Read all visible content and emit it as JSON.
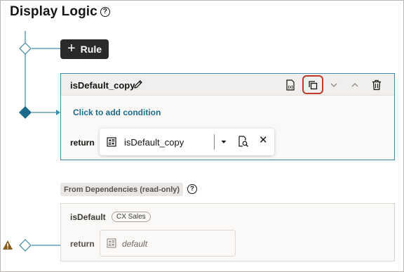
{
  "page": {
    "title": "Display Logic"
  },
  "toolbar": {
    "add_rule_label": "Rule"
  },
  "rule": {
    "name": "isDefault_copy",
    "add_condition_label": "Click to add condition",
    "return_label": "return",
    "return_value": "isDefault_copy",
    "header_icons": [
      "test-icon",
      "duplicate-icon",
      "chevron-down-icon",
      "chevron-up-icon",
      "trash-icon"
    ]
  },
  "dependencies": {
    "badge_label": "From Dependencies (read-only)",
    "items": [
      {
        "name": "isDefault",
        "tag": "CX Sales",
        "return_label": "return",
        "return_placeholder": "default"
      }
    ]
  },
  "colors": {
    "connector": "#3f8aa8",
    "rule_button_bg": "#2b2a28",
    "highlight": "#c0392b",
    "link": "#1d6a8c",
    "warning": "#8a5a1b"
  }
}
